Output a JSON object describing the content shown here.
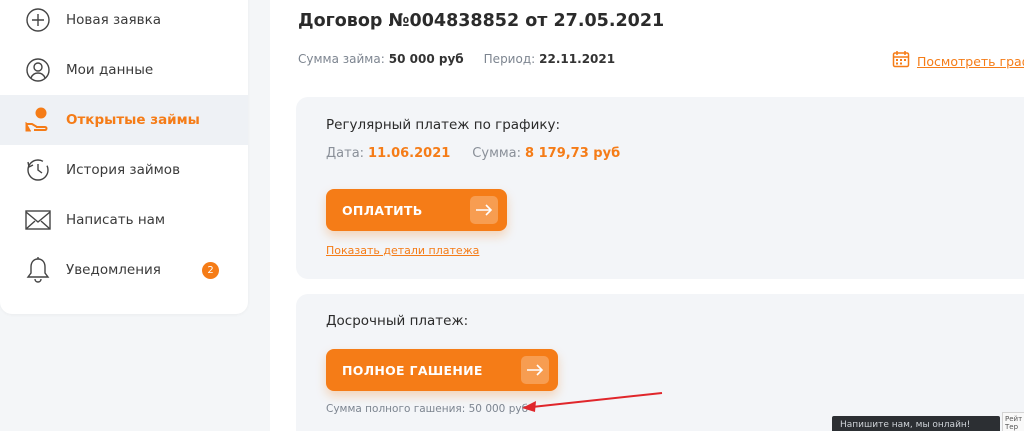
{
  "sidebar": {
    "items": [
      {
        "label": "Новая заявка",
        "icon": "plus-circle-icon",
        "active": false
      },
      {
        "label": "Мои данные",
        "icon": "user-icon",
        "active": false
      },
      {
        "label": "Открытые займы",
        "icon": "coin-hand-icon",
        "active": true
      },
      {
        "label": "История займов",
        "icon": "history-icon",
        "active": false
      },
      {
        "label": "Написать нам",
        "icon": "envelope-icon",
        "active": false
      },
      {
        "label": "Уведомления",
        "icon": "bell-icon",
        "active": false,
        "badge": "2"
      }
    ]
  },
  "contract": {
    "title": "Договор №004838852 от 27.05.2021",
    "amount_label": "Сумма займа:",
    "amount_value": "50 000 руб",
    "period_label": "Период:",
    "period_value": "22.11.2021",
    "schedule_link": "Посмотреть графи"
  },
  "regular_payment": {
    "heading": "Регулярный платеж по графику:",
    "date_label": "Дата:",
    "date_value": "11.06.2021",
    "sum_label": "Сумма:",
    "sum_value": "8 179,73 руб",
    "pay_button": "ОПЛАТИТЬ",
    "details_link": "Показать детали платежа"
  },
  "early_payment": {
    "heading": "Досрочный платеж:",
    "full_button": "ПОЛНОЕ ГАШЕНИЕ",
    "full_amount_note": "Сумма полного гашения: 50 000 руб"
  },
  "overlay": {
    "tooltip_text": "Напишите нам, мы онлайн!",
    "recaptcha_text": "Рейт Тер"
  },
  "colors": {
    "accent": "#f57c17",
    "card_bg": "#f3f5f8",
    "annotation_arrow": "#e0262b"
  }
}
